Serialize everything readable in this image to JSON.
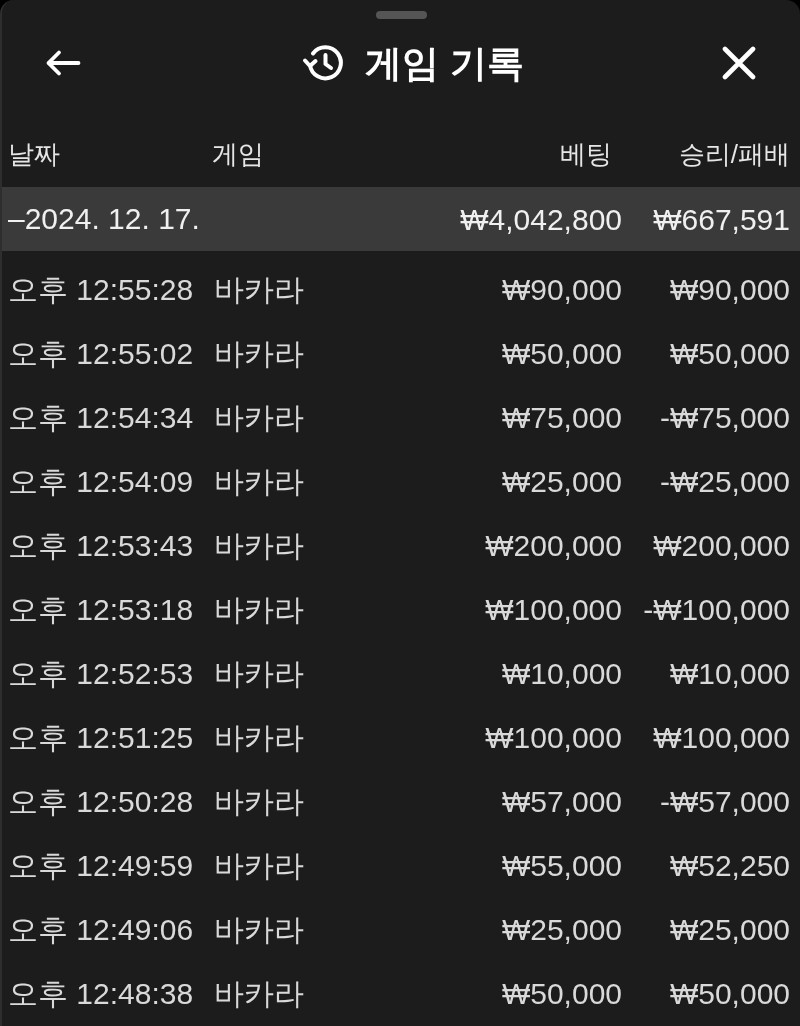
{
  "header": {
    "title": "게임 기록"
  },
  "table": {
    "columns": [
      "날짜",
      "게임",
      "베팅",
      "승리/패배"
    ],
    "groups": [
      {
        "toggle": "–",
        "date": "2024. 12. 17.",
        "expanded": true,
        "bet_total": "₩4,042,800",
        "result_total": "₩667,591",
        "rows": [
          {
            "time": "오후 12:55:28",
            "game": "바카라",
            "bet": "₩90,000",
            "result": "₩90,000"
          },
          {
            "time": "오후 12:55:02",
            "game": "바카라",
            "bet": "₩50,000",
            "result": "₩50,000"
          },
          {
            "time": "오후 12:54:34",
            "game": "바카라",
            "bet": "₩75,000",
            "result": "-₩75,000"
          },
          {
            "time": "오후 12:54:09",
            "game": "바카라",
            "bet": "₩25,000",
            "result": "-₩25,000"
          },
          {
            "time": "오후 12:53:43",
            "game": "바카라",
            "bet": "₩200,000",
            "result": "₩200,000"
          },
          {
            "time": "오후 12:53:18",
            "game": "바카라",
            "bet": "₩100,000",
            "result": "-₩100,000"
          },
          {
            "time": "오후 12:52:53",
            "game": "바카라",
            "bet": "₩10,000",
            "result": "₩10,000"
          },
          {
            "time": "오후 12:51:25",
            "game": "바카라",
            "bet": "₩100,000",
            "result": "₩100,000"
          },
          {
            "time": "오후 12:50:28",
            "game": "바카라",
            "bet": "₩57,000",
            "result": "-₩57,000"
          },
          {
            "time": "오후 12:49:59",
            "game": "바카라",
            "bet": "₩55,000",
            "result": "₩52,250"
          },
          {
            "time": "오후 12:49:06",
            "game": "바카라",
            "bet": "₩25,000",
            "result": "₩25,000"
          },
          {
            "time": "오후 12:48:38",
            "game": "바카라",
            "bet": "₩50,000",
            "result": "₩50,000"
          }
        ]
      }
    ]
  }
}
